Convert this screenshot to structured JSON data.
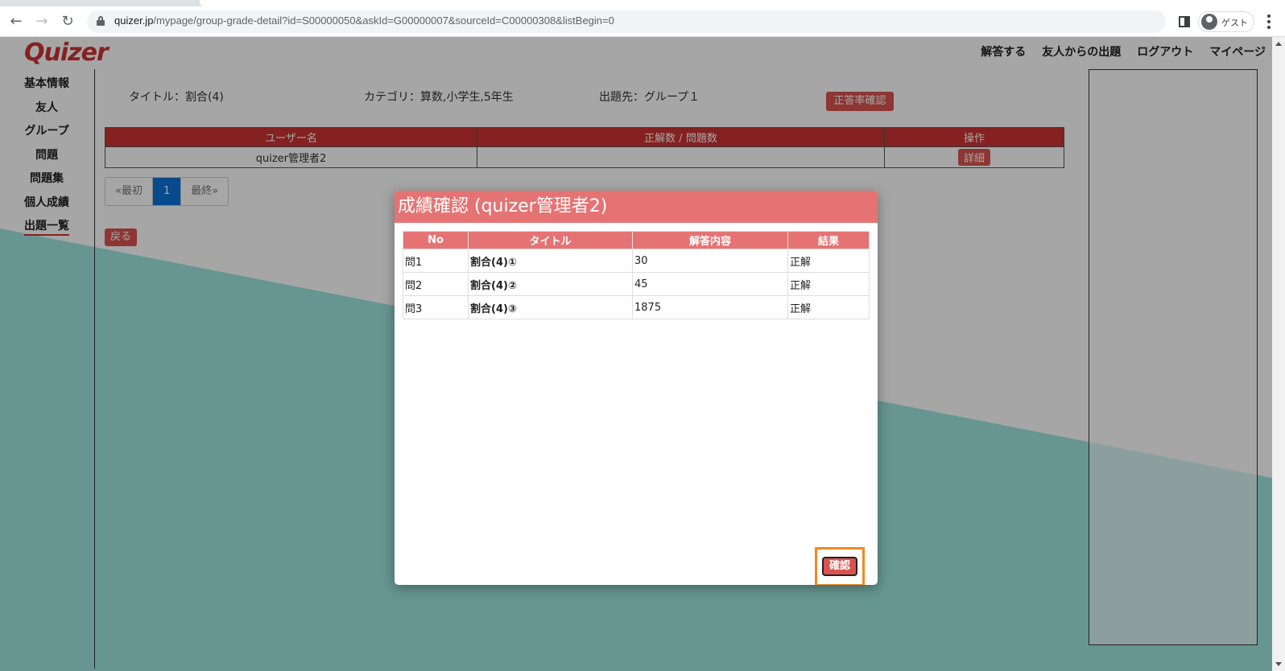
{
  "browser": {
    "url_host": "quizer.jp",
    "url_path": "/mypage/group-grade-detail?id=S00000050&askId=G00000007&sourceId=C00000308&listBegin=0",
    "profile_label": "ゲスト"
  },
  "header": {
    "logo": "Quizer",
    "nav": [
      "解答する",
      "友人からの出題",
      "ログアウト",
      "マイページ"
    ]
  },
  "sidebar": {
    "items": [
      "基本情報",
      "友人",
      "グループ",
      "問題",
      "問題集",
      "個人成績",
      "出題一覧"
    ],
    "active_index": 6
  },
  "info": {
    "title": "タイトル：割合(4)",
    "category": "カテゴリ：算数,小学生,5年生",
    "target": "出題先：グループ１",
    "rate_button": "正答率確認"
  },
  "grid": {
    "columns": [
      "ユーザー名",
      "正解数 / 問題数",
      "操作"
    ],
    "rows": [
      {
        "user": "quizer管理者2",
        "score": "",
        "action": "詳細"
      }
    ]
  },
  "pager": {
    "first": "«最初",
    "current": "1",
    "last": "最終»"
  },
  "back_button": "戻る",
  "modal": {
    "title": "成績確認 (quizer管理者2)",
    "columns": [
      "No",
      "タイトル",
      "解答内容",
      "結果"
    ],
    "rows": [
      {
        "no": "問1",
        "title": "割合(4)①",
        "answer": "30",
        "result": "正解"
      },
      {
        "no": "問2",
        "title": "割合(4)②",
        "answer": "45",
        "result": "正解"
      },
      {
        "no": "問3",
        "title": "割合(4)③",
        "answer": "1875",
        "result": "正解"
      }
    ],
    "confirm_label": "確認"
  },
  "colors": {
    "accent_red": "#cc3333",
    "modal_header": "#e57373",
    "teal": "#9ee6e0",
    "highlight": "#f08a24",
    "pager_active": "#0b72d9"
  }
}
